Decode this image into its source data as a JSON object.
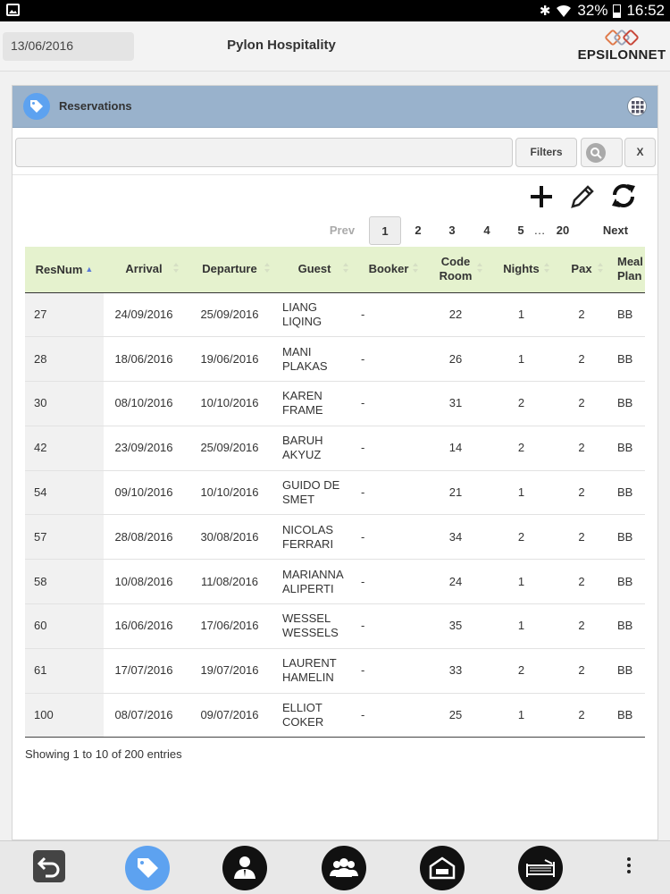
{
  "status_bar": {
    "battery": "32%",
    "time": "16:52"
  },
  "header": {
    "date": "13/06/2016",
    "title": "Pylon Hospitality",
    "logo_text": "EPSILONNET"
  },
  "panel": {
    "title": "Reservations",
    "search": {
      "value": "",
      "placeholder": ""
    },
    "filters_label": "Filters",
    "clear_label": "X"
  },
  "pagination": {
    "prev": "Prev",
    "pages": [
      "1",
      "2",
      "3",
      "4",
      "5"
    ],
    "ellipsis": "…",
    "last": "20",
    "next": "Next",
    "current": "1"
  },
  "table": {
    "columns": [
      "ResNum",
      "Arrival",
      "Departure",
      "Guest",
      "Booker",
      "Code Room",
      "Nights",
      "Pax",
      "Meal Plan"
    ],
    "sorted_column": "ResNum",
    "sort_direction": "asc",
    "rows": [
      {
        "resnum": "27",
        "arrival": "24/09/2016",
        "departure": "25/09/2016",
        "guest": "LIANG LIQING",
        "booker": "-",
        "room": "22",
        "nights": "1",
        "pax": "2",
        "meal": "BB"
      },
      {
        "resnum": "28",
        "arrival": "18/06/2016",
        "departure": "19/06/2016",
        "guest": "MANI PLAKAS",
        "booker": "-",
        "room": "26",
        "nights": "1",
        "pax": "2",
        "meal": "BB"
      },
      {
        "resnum": "30",
        "arrival": "08/10/2016",
        "departure": "10/10/2016",
        "guest": "KAREN FRAME",
        "booker": "-",
        "room": "31",
        "nights": "2",
        "pax": "2",
        "meal": "BB"
      },
      {
        "resnum": "42",
        "arrival": "23/09/2016",
        "departure": "25/09/2016",
        "guest": "BARUH AKYUZ",
        "booker": "-",
        "room": "14",
        "nights": "2",
        "pax": "2",
        "meal": "BB"
      },
      {
        "resnum": "54",
        "arrival": "09/10/2016",
        "departure": "10/10/2016",
        "guest": "GUIDO DE SMET",
        "booker": "-",
        "room": "21",
        "nights": "1",
        "pax": "2",
        "meal": "BB"
      },
      {
        "resnum": "57",
        "arrival": "28/08/2016",
        "departure": "30/08/2016",
        "guest": "NICOLAS FERRARI",
        "booker": "-",
        "room": "34",
        "nights": "2",
        "pax": "2",
        "meal": "BB"
      },
      {
        "resnum": "58",
        "arrival": "10/08/2016",
        "departure": "11/08/2016",
        "guest": "MARIANNA ALIPERTI",
        "booker": "-",
        "room": "24",
        "nights": "1",
        "pax": "2",
        "meal": "BB"
      },
      {
        "resnum": "60",
        "arrival": "16/06/2016",
        "departure": "17/06/2016",
        "guest": "WESSEL WESSELS",
        "booker": "-",
        "room": "35",
        "nights": "1",
        "pax": "2",
        "meal": "BB"
      },
      {
        "resnum": "61",
        "arrival": "17/07/2016",
        "departure": "19/07/2016",
        "guest": "LAURENT HAMELIN",
        "booker": "-",
        "room": "33",
        "nights": "2",
        "pax": "2",
        "meal": "BB"
      },
      {
        "resnum": "100",
        "arrival": "08/07/2016",
        "departure": "09/07/2016",
        "guest": "ELLIOT COKER",
        "booker": "-",
        "room": "25",
        "nights": "1",
        "pax": "2",
        "meal": "BB"
      }
    ]
  },
  "info": "Showing 1 to 10 of 200 entries",
  "bottom_nav": [
    "back-icon",
    "tag-icon",
    "person-icon",
    "group-icon",
    "building-icon",
    "bed-icon",
    "more-icon"
  ],
  "colors": {
    "header_bar": "#99b2cc",
    "table_header": "#e5f2ce",
    "accent": "#5da2f0"
  }
}
